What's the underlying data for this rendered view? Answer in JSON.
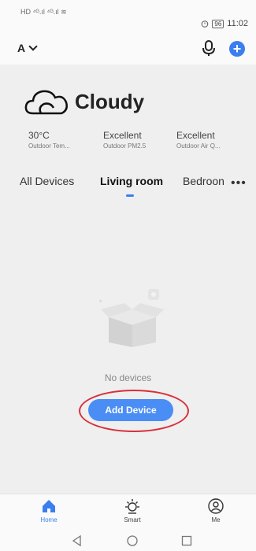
{
  "status_bar": {
    "left_text": "HD ⁴ᴳ.ıl ⁴ᴳ.ıl ≋",
    "battery": "96",
    "time": "11:02"
  },
  "header": {
    "home_name": "A"
  },
  "weather": {
    "condition": "Cloudy",
    "stats": [
      {
        "value": "30°C",
        "label": "Outdoor Tem..."
      },
      {
        "value": "Excellent",
        "label": "Outdoor PM2.5"
      },
      {
        "value": "Excellent",
        "label": "Outdoor Air Q..."
      }
    ]
  },
  "tabs": [
    {
      "label": "All Devices",
      "active": false
    },
    {
      "label": "Living room",
      "active": true
    },
    {
      "label": "Bedroon",
      "active": false
    }
  ],
  "tabs_more": "•••",
  "empty_state": {
    "message": "No devices",
    "button_label": "Add Device"
  },
  "bottom_nav": [
    {
      "label": "Home",
      "active": true
    },
    {
      "label": "Smart",
      "active": false
    },
    {
      "label": "Me",
      "active": false
    }
  ],
  "colors": {
    "accent": "#3b7ef0",
    "highlight_ring": "#d8303a"
  }
}
